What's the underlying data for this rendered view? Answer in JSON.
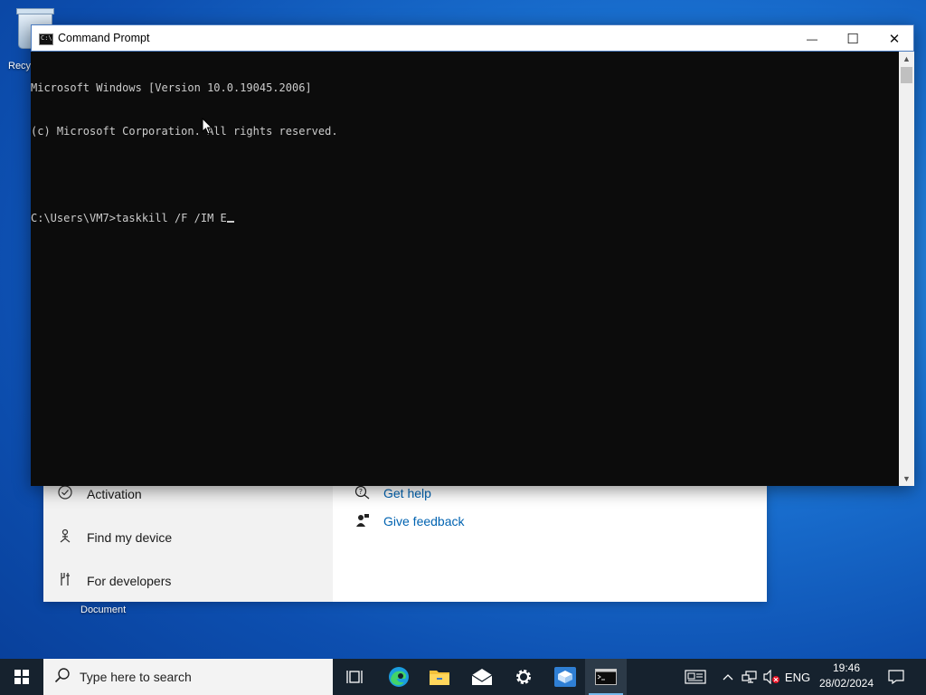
{
  "desktop": {
    "recycle_bin_label": "Recy",
    "document_label": "Document"
  },
  "settings_window": {
    "left_items": [
      {
        "label": "Activation",
        "icon": "check-circle-icon"
      },
      {
        "label": "Find my device",
        "icon": "person-pin-icon"
      },
      {
        "label": "For developers",
        "icon": "developer-tools-icon"
      }
    ],
    "right_links": [
      {
        "label": "Get help",
        "icon": "help-chat-icon"
      },
      {
        "label": "Give feedback",
        "icon": "feedback-icon"
      }
    ]
  },
  "cmd_window": {
    "title": "Command Prompt",
    "icon_text": "C:\\",
    "controls": {
      "minimize": "—",
      "maximize": "☐",
      "close": "✕"
    },
    "lines": [
      "Microsoft Windows [Version 10.0.19045.2006]",
      "(c) Microsoft Corporation. All rights reserved.",
      "",
      "C:\\Users\\VM7>taskkill /F /IM E"
    ]
  },
  "taskbar": {
    "search_placeholder": "Type here to search",
    "pinned": [
      {
        "name": "task-view-button",
        "icon": "task-view-icon"
      },
      {
        "name": "edge-button",
        "icon": "edge-icon"
      },
      {
        "name": "file-explorer-button",
        "icon": "folder-icon"
      },
      {
        "name": "mail-button",
        "icon": "mail-icon"
      },
      {
        "name": "settings-button",
        "icon": "gear-icon"
      },
      {
        "name": "package-app-button",
        "icon": "package-icon"
      },
      {
        "name": "command-prompt-button",
        "icon": "cmd-icon",
        "active": true
      }
    ],
    "tray": {
      "language": "ENG",
      "time": "19:46",
      "date": "28/02/2024"
    }
  },
  "colors": {
    "taskbar": "#16222e",
    "console_bg": "#0c0c0c",
    "console_fg": "#cccccc",
    "link": "#0063b1",
    "active_indicator": "#76b9ed"
  }
}
